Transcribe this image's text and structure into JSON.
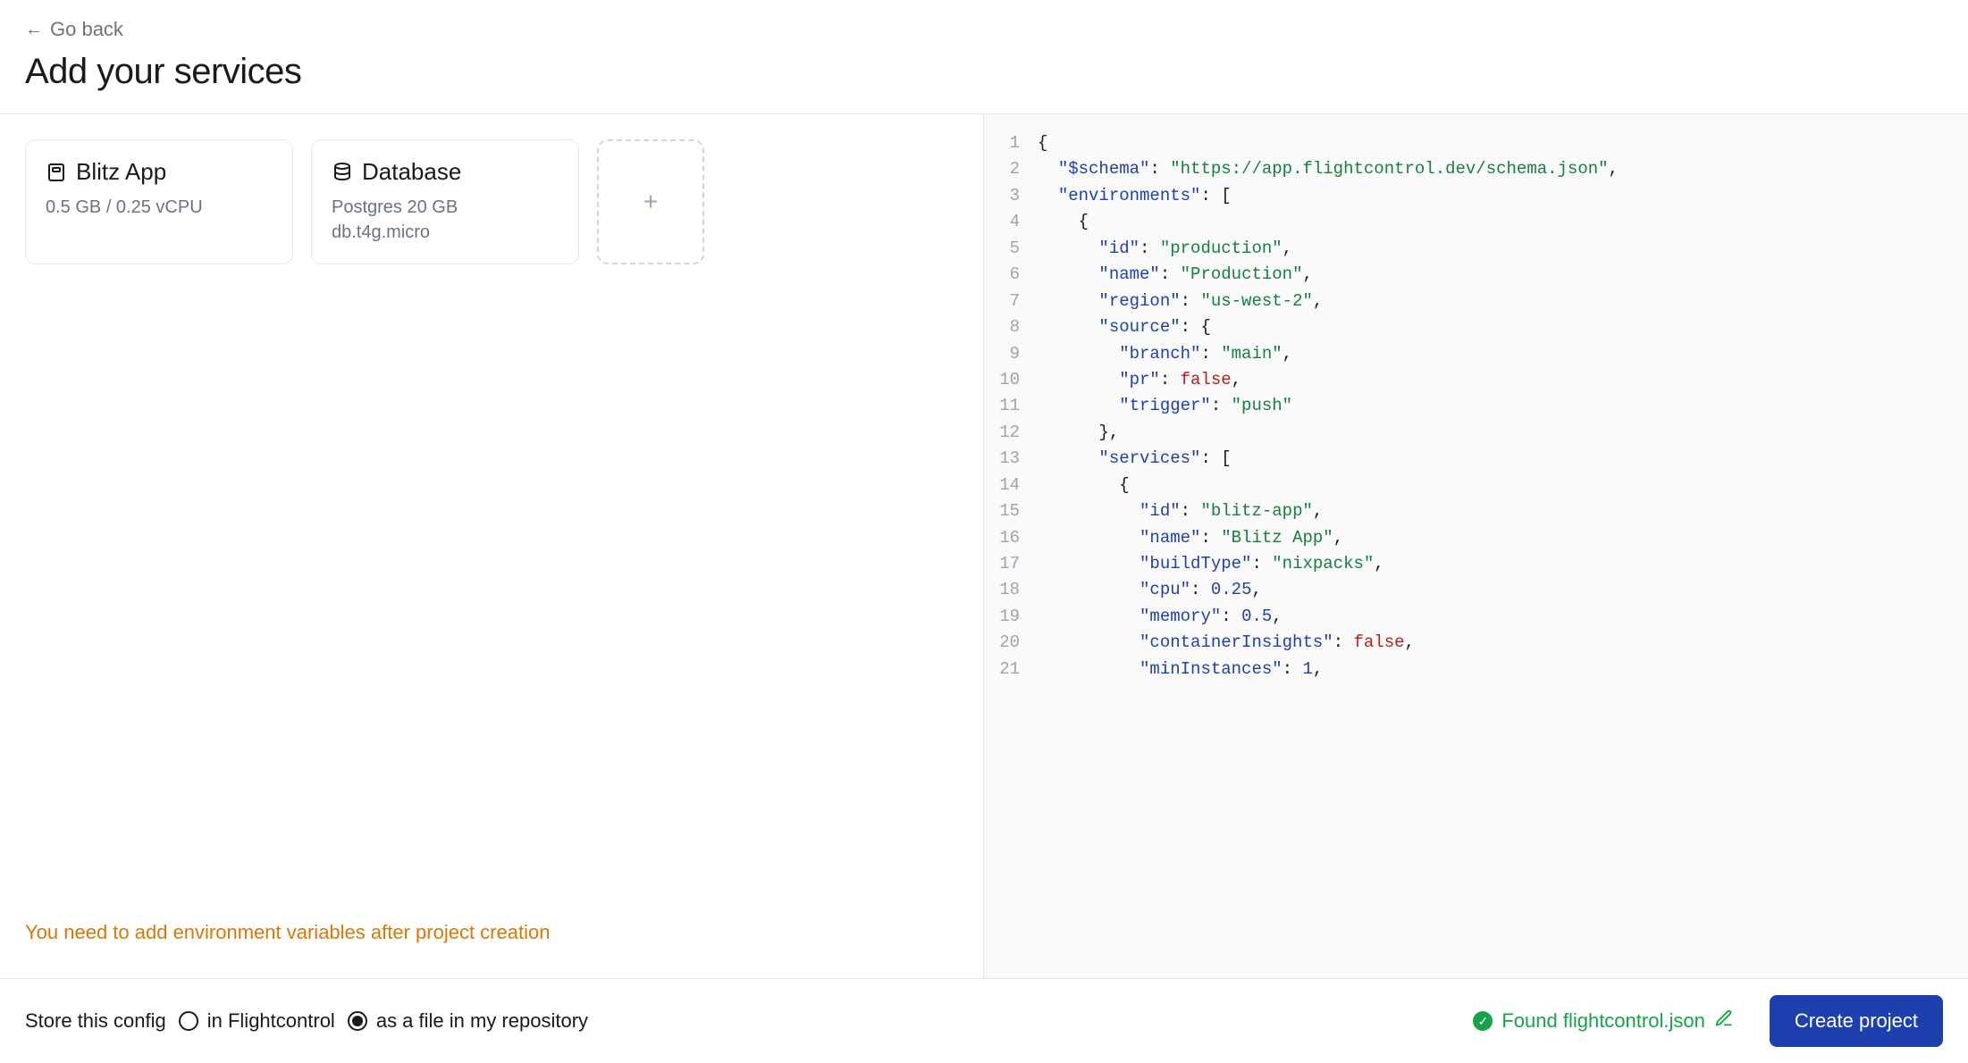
{
  "header": {
    "back_label": "Go back",
    "title": "Add your services"
  },
  "services": [
    {
      "icon": "container-icon",
      "title": "Blitz App",
      "subtitle": "0.5 GB / 0.25 vCPU"
    },
    {
      "icon": "database-icon",
      "title": "Database",
      "subtitle_line1": "Postgres 20 GB",
      "subtitle_line2": "db.t4g.micro"
    }
  ],
  "warning": "You need to add environment variables after project creation",
  "code": {
    "lines": [
      {
        "n": 1,
        "tokens": [
          [
            "punc",
            "{"
          ]
        ]
      },
      {
        "n": 2,
        "tokens": [
          [
            "ind",
            "  "
          ],
          [
            "key",
            "\"$schema\""
          ],
          [
            "punc",
            ": "
          ],
          [
            "str",
            "\"https://app.flightcontrol.dev/schema.json\""
          ],
          [
            "punc",
            ","
          ]
        ]
      },
      {
        "n": 3,
        "tokens": [
          [
            "ind",
            "  "
          ],
          [
            "key",
            "\"environments\""
          ],
          [
            "punc",
            ": ["
          ]
        ]
      },
      {
        "n": 4,
        "tokens": [
          [
            "ind",
            "    "
          ],
          [
            "punc",
            "{"
          ]
        ]
      },
      {
        "n": 5,
        "tokens": [
          [
            "ind",
            "      "
          ],
          [
            "key",
            "\"id\""
          ],
          [
            "punc",
            ": "
          ],
          [
            "str",
            "\"production\""
          ],
          [
            "punc",
            ","
          ]
        ]
      },
      {
        "n": 6,
        "tokens": [
          [
            "ind",
            "      "
          ],
          [
            "key",
            "\"name\""
          ],
          [
            "punc",
            ": "
          ],
          [
            "str",
            "\"Production\""
          ],
          [
            "punc",
            ","
          ]
        ]
      },
      {
        "n": 7,
        "tokens": [
          [
            "ind",
            "      "
          ],
          [
            "key",
            "\"region\""
          ],
          [
            "punc",
            ": "
          ],
          [
            "str",
            "\"us-west-2\""
          ],
          [
            "punc",
            ","
          ]
        ]
      },
      {
        "n": 8,
        "tokens": [
          [
            "ind",
            "      "
          ],
          [
            "key",
            "\"source\""
          ],
          [
            "punc",
            ": {"
          ]
        ]
      },
      {
        "n": 9,
        "tokens": [
          [
            "ind",
            "        "
          ],
          [
            "key",
            "\"branch\""
          ],
          [
            "punc",
            ": "
          ],
          [
            "str",
            "\"main\""
          ],
          [
            "punc",
            ","
          ]
        ]
      },
      {
        "n": 10,
        "tokens": [
          [
            "ind",
            "        "
          ],
          [
            "key",
            "\"pr\""
          ],
          [
            "punc",
            ": "
          ],
          [
            "bool",
            "false"
          ],
          [
            "punc",
            ","
          ]
        ]
      },
      {
        "n": 11,
        "tokens": [
          [
            "ind",
            "        "
          ],
          [
            "key",
            "\"trigger\""
          ],
          [
            "punc",
            ": "
          ],
          [
            "str",
            "\"push\""
          ]
        ]
      },
      {
        "n": 12,
        "tokens": [
          [
            "ind",
            "      "
          ],
          [
            "punc",
            "},"
          ]
        ]
      },
      {
        "n": 13,
        "tokens": [
          [
            "ind",
            "      "
          ],
          [
            "key",
            "\"services\""
          ],
          [
            "punc",
            ": ["
          ]
        ]
      },
      {
        "n": 14,
        "tokens": [
          [
            "ind",
            "        "
          ],
          [
            "punc",
            "{"
          ]
        ]
      },
      {
        "n": 15,
        "tokens": [
          [
            "ind",
            "          "
          ],
          [
            "key",
            "\"id\""
          ],
          [
            "punc",
            ": "
          ],
          [
            "str",
            "\"blitz-app\""
          ],
          [
            "punc",
            ","
          ]
        ]
      },
      {
        "n": 16,
        "tokens": [
          [
            "ind",
            "          "
          ],
          [
            "key",
            "\"name\""
          ],
          [
            "punc",
            ": "
          ],
          [
            "str",
            "\"Blitz App\""
          ],
          [
            "punc",
            ","
          ]
        ]
      },
      {
        "n": 17,
        "tokens": [
          [
            "ind",
            "          "
          ],
          [
            "key",
            "\"buildType\""
          ],
          [
            "punc",
            ": "
          ],
          [
            "str",
            "\"nixpacks\""
          ],
          [
            "punc",
            ","
          ]
        ]
      },
      {
        "n": 18,
        "tokens": [
          [
            "ind",
            "          "
          ],
          [
            "key",
            "\"cpu\""
          ],
          [
            "punc",
            ": "
          ],
          [
            "num",
            "0.25"
          ],
          [
            "punc",
            ","
          ]
        ]
      },
      {
        "n": 19,
        "tokens": [
          [
            "ind",
            "          "
          ],
          [
            "key",
            "\"memory\""
          ],
          [
            "punc",
            ": "
          ],
          [
            "num",
            "0.5"
          ],
          [
            "punc",
            ","
          ]
        ]
      },
      {
        "n": 20,
        "tokens": [
          [
            "ind",
            "          "
          ],
          [
            "key",
            "\"containerInsights\""
          ],
          [
            "punc",
            ": "
          ],
          [
            "bool",
            "false"
          ],
          [
            "punc",
            ","
          ]
        ]
      },
      {
        "n": 21,
        "tokens": [
          [
            "ind",
            "          "
          ],
          [
            "key",
            "\"minInstances\""
          ],
          [
            "punc",
            ": "
          ],
          [
            "num",
            "1"
          ],
          [
            "punc",
            ","
          ]
        ]
      }
    ]
  },
  "footer": {
    "store_label": "Store this config",
    "option_flightcontrol": "in Flightcontrol",
    "option_repo": "as a file in my repository",
    "selected": "repo",
    "found_label": "Found flightcontrol.json",
    "create_label": "Create project"
  }
}
